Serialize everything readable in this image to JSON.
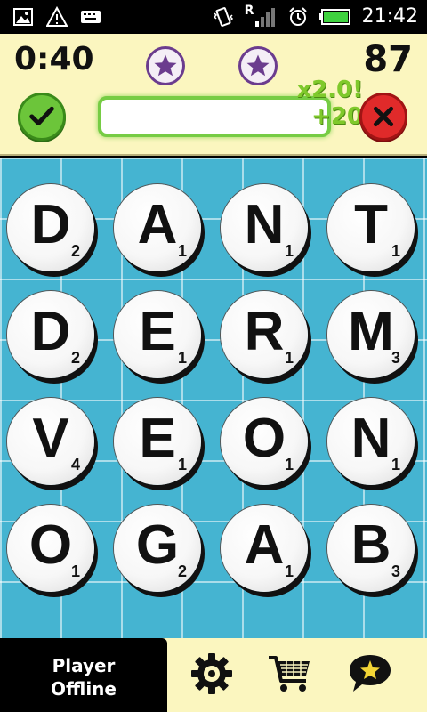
{
  "status_bar": {
    "time": "21:42",
    "network_indicator": "R",
    "icons_left": [
      "image-icon",
      "warning-icon",
      "keyboard-icon"
    ],
    "icons_right": [
      "vibrate-icon",
      "signal-icon",
      "alarm-icon",
      "battery-icon"
    ]
  },
  "header": {
    "timer": "0:40",
    "score": "87",
    "stars": [
      "star-icon",
      "star-icon"
    ],
    "word_field_value": "",
    "bonus_multiplier": "x2.0!",
    "bonus_points": "+20"
  },
  "board": {
    "tiles": [
      {
        "letter": "D",
        "points": "2"
      },
      {
        "letter": "A",
        "points": "1"
      },
      {
        "letter": "N",
        "points": "1"
      },
      {
        "letter": "T",
        "points": "1"
      },
      {
        "letter": "D",
        "points": "2"
      },
      {
        "letter": "E",
        "points": "1"
      },
      {
        "letter": "R",
        "points": "1"
      },
      {
        "letter": "M",
        "points": "3"
      },
      {
        "letter": "V",
        "points": "4"
      },
      {
        "letter": "E",
        "points": "1"
      },
      {
        "letter": "O",
        "points": "1"
      },
      {
        "letter": "N",
        "points": "1"
      },
      {
        "letter": "O",
        "points": "1"
      },
      {
        "letter": "G",
        "points": "2"
      },
      {
        "letter": "A",
        "points": "1"
      },
      {
        "letter": "B",
        "points": "3"
      }
    ]
  },
  "bottom_bar": {
    "player_line1": "Player",
    "player_line2": "Offline",
    "icons": [
      "settings-gear-icon",
      "shopping-cart-icon",
      "achievements-star-bubble-icon"
    ]
  },
  "colors": {
    "header_bg": "#fbf6bf",
    "board_bg": "#45b4d1",
    "accept_green": "#6cc53a",
    "cancel_red": "#e02a2a",
    "star_purple": "#6b3c8e",
    "bonus_green": "#7fc92b"
  }
}
